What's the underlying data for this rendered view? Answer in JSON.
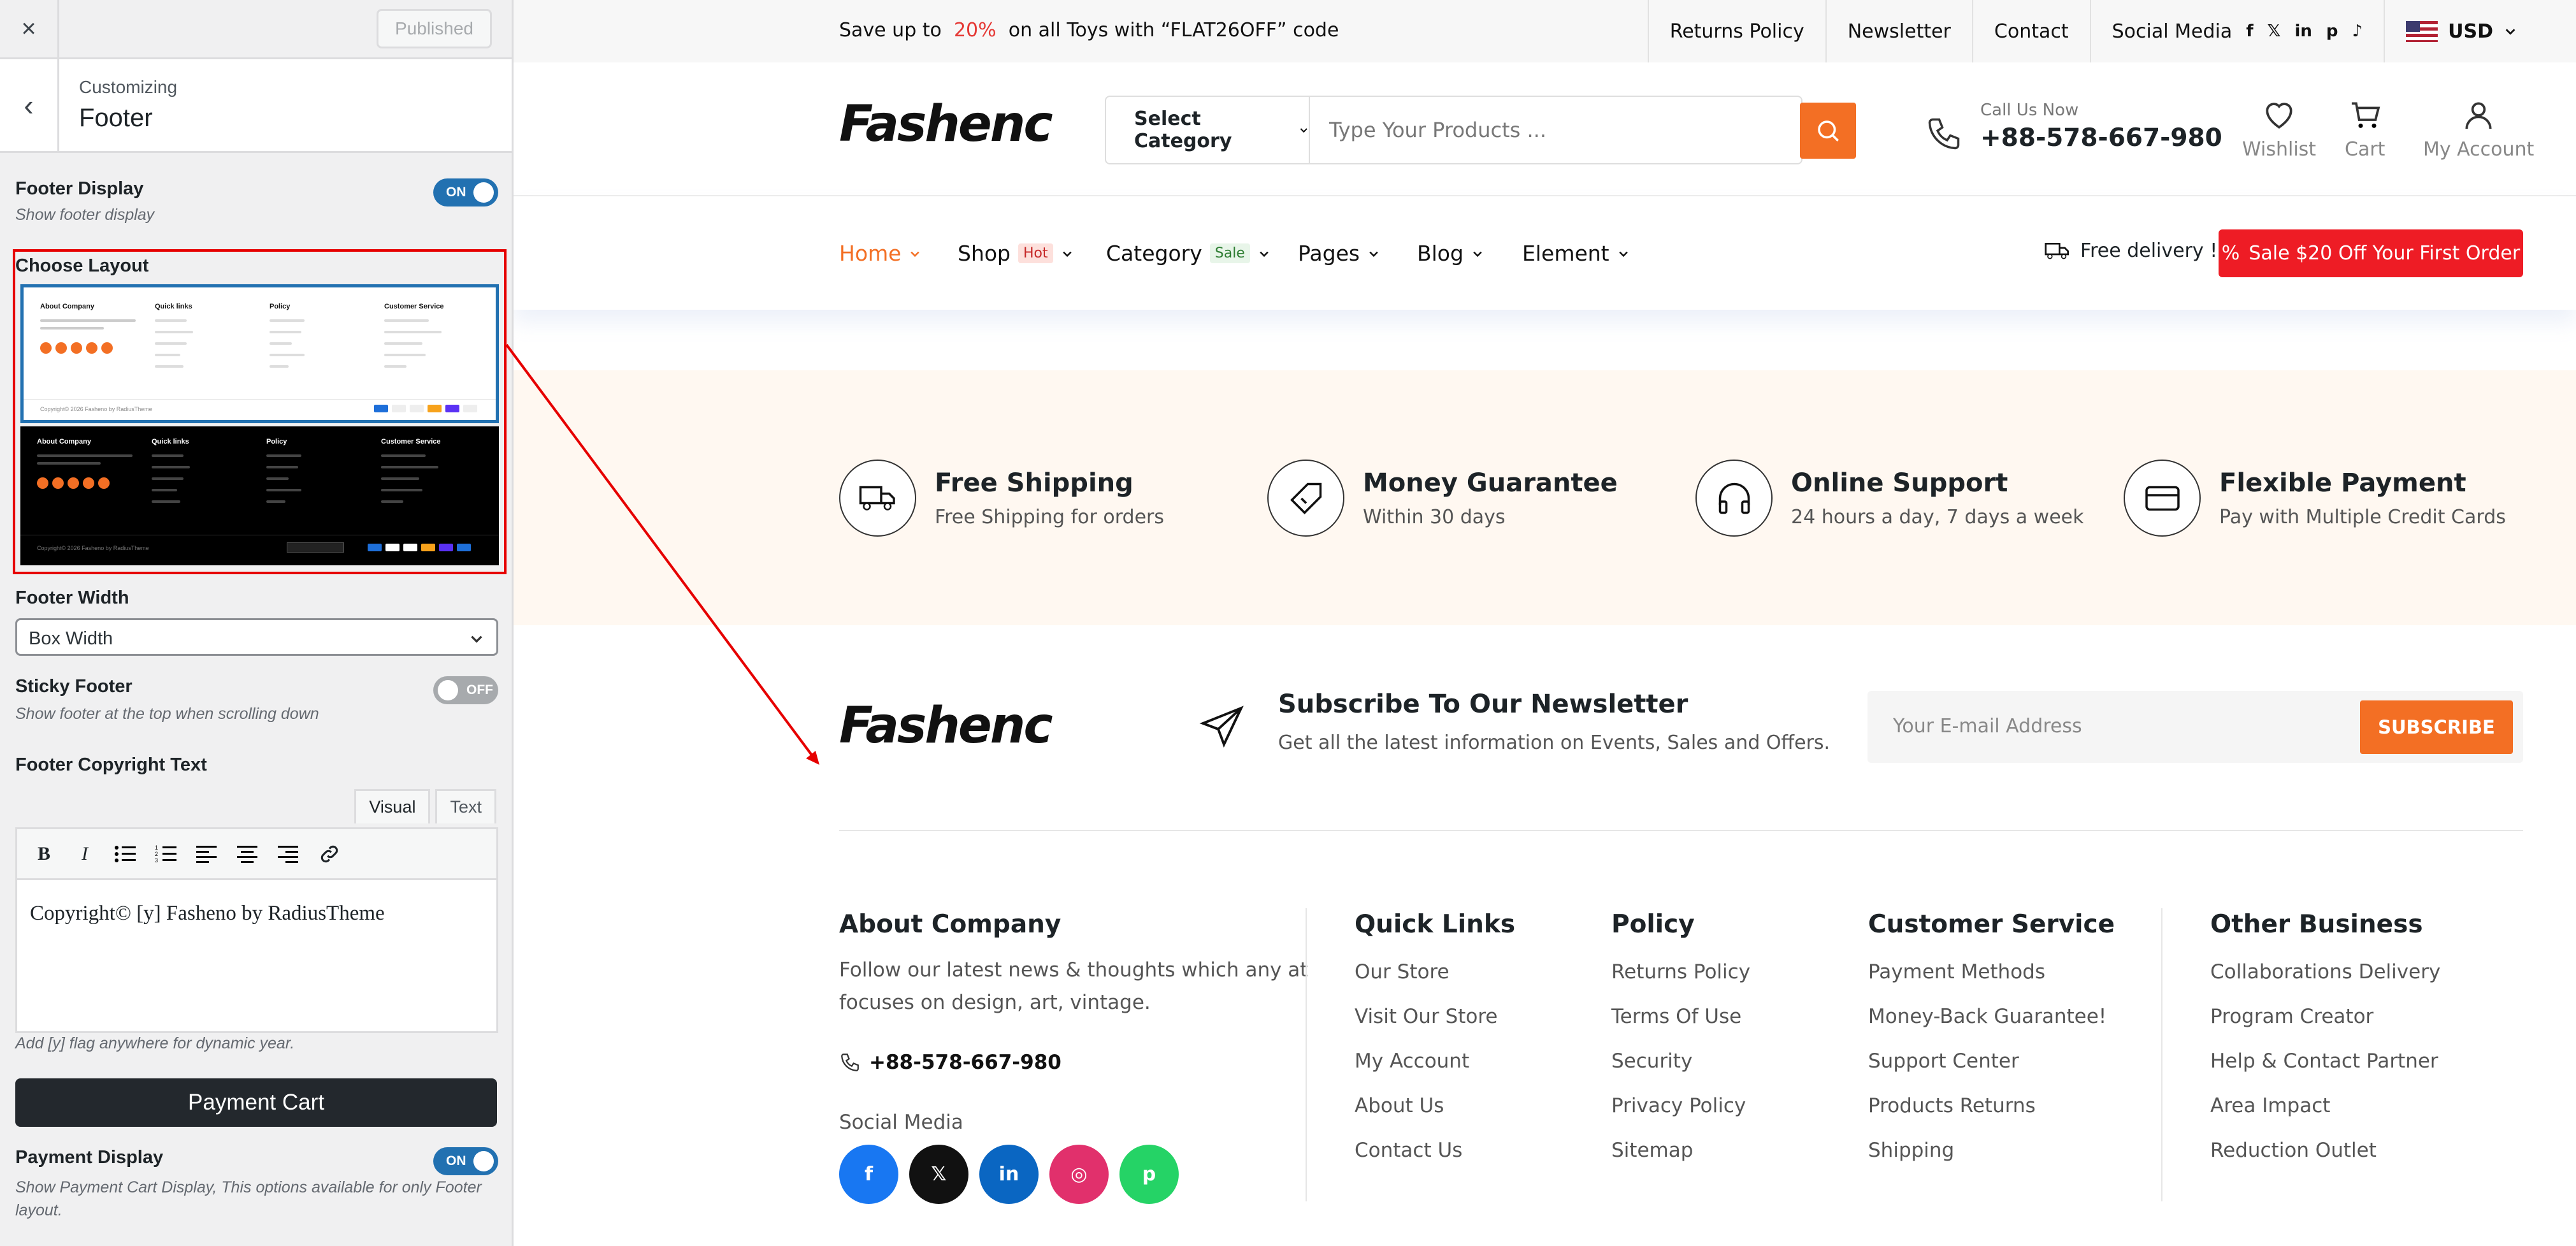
{
  "sidebar": {
    "close_icon": "×",
    "published_label": "Published",
    "back_icon": "‹",
    "section_parent": "Customizing",
    "section_title": "Footer",
    "footer_display": {
      "title": "Footer Display",
      "desc": "Show footer display",
      "state": "ON"
    },
    "choose_layout": {
      "title": "Choose Layout",
      "mini": {
        "about": "About Company",
        "quick": "Quick links",
        "policy": "Policy",
        "service": "Customer Service",
        "copyright": "Copyright© 2026 Fasheno by RadiusTheme"
      }
    },
    "footer_width": {
      "title": "Footer Width",
      "value": "Box Width"
    },
    "sticky_footer": {
      "title": "Sticky Footer",
      "desc": "Show footer at the top when scrolling down",
      "state": "OFF"
    },
    "copyright": {
      "title": "Footer Copyright Text",
      "tab_visual": "Visual",
      "tab_text": "Text",
      "toolbar": [
        "bold-icon",
        "italic-icon",
        "bullet-list-icon",
        "numbered-list-icon",
        "align-left-icon",
        "align-center-icon",
        "align-right-icon",
        "link-icon"
      ],
      "value": "Copyright© [y] Fasheno by RadiusTheme",
      "hint": "Add [y] flag anywhere for dynamic year."
    },
    "payment_cart_button": "Payment Cart",
    "payment_display": {
      "title": "Payment Display",
      "desc": "Show Payment Cart Display, This options available for only Footer layout.",
      "state": "ON"
    }
  },
  "site": {
    "topbar": {
      "promo_pre": "Save up to",
      "promo_pct": "20%",
      "promo_post": "on all Toys with “FLAT26OFF” code",
      "links": [
        "Returns Policy",
        "Newsletter",
        "Contact",
        "Social Media"
      ],
      "social_icons": [
        "f",
        "𝕏",
        "in",
        "p",
        "♪"
      ],
      "currency": "USD"
    },
    "header": {
      "logo": "Fashenc",
      "category_label": "Select Category",
      "search_placeholder": "Type Your Products ...",
      "call_label": "Call Us Now",
      "call_number": "+88-578-667-980",
      "wishlist": "Wishlist",
      "cart": "Cart",
      "account": "My Account"
    },
    "nav": {
      "items": [
        "Home",
        "Shop",
        "Category",
        "Pages",
        "Blog",
        "Element"
      ],
      "badge_hot": "Hot",
      "badge_sale": "Sale",
      "free_delivery": "Free delivery !",
      "sale_button": "Sale $20 Off Your First Order"
    },
    "features": [
      {
        "title": "Free Shipping",
        "sub": "Free Shipping for orders"
      },
      {
        "title": "Money Guarantee",
        "sub": "Within 30 days"
      },
      {
        "title": "Online Support",
        "sub": "24 hours a day, 7 days a week"
      },
      {
        "title": "Flexible Payment",
        "sub": "Pay with Multiple Credit Cards"
      }
    ],
    "newsletter": {
      "title": "Subscribe To Our Newsletter",
      "sub": "Get all the latest information on Events, Sales and Offers.",
      "placeholder": "Your E-mail Address",
      "button": "SUBSCRIBE"
    },
    "footer": {
      "about_title": "About Company",
      "about_text_1": "Follow our latest news & thoughts which any at",
      "about_text_2": "focuses on design, art, vintage.",
      "phone": "+88-578-667-980",
      "social_label": "Social Media",
      "social": [
        "f",
        "𝕏",
        "in",
        "◎",
        "p"
      ],
      "columns": [
        {
          "title": "Quick Links",
          "links": [
            "Our Store",
            "Visit Our Store",
            "My Account",
            "About Us",
            "Contact Us"
          ]
        },
        {
          "title": "Policy",
          "links": [
            "Returns Policy",
            "Terms Of Use",
            "Security",
            "Privacy Policy",
            "Sitemap"
          ]
        },
        {
          "title": "Customer Service",
          "links": [
            "Payment Methods",
            "Money-Back Guarantee!",
            "Support Center",
            "Products Returns",
            "Shipping"
          ]
        },
        {
          "title": "Other Business",
          "links": [
            "Collaborations Delivery",
            "Program Creator",
            "Help & Contact Partner",
            "Area Impact",
            "Reduction Outlet"
          ]
        }
      ]
    }
  },
  "colors": {
    "accent": "#f36f24",
    "toggle_on": "#2271b1",
    "highlight": "#e60000",
    "sale": "#ee1c25"
  }
}
